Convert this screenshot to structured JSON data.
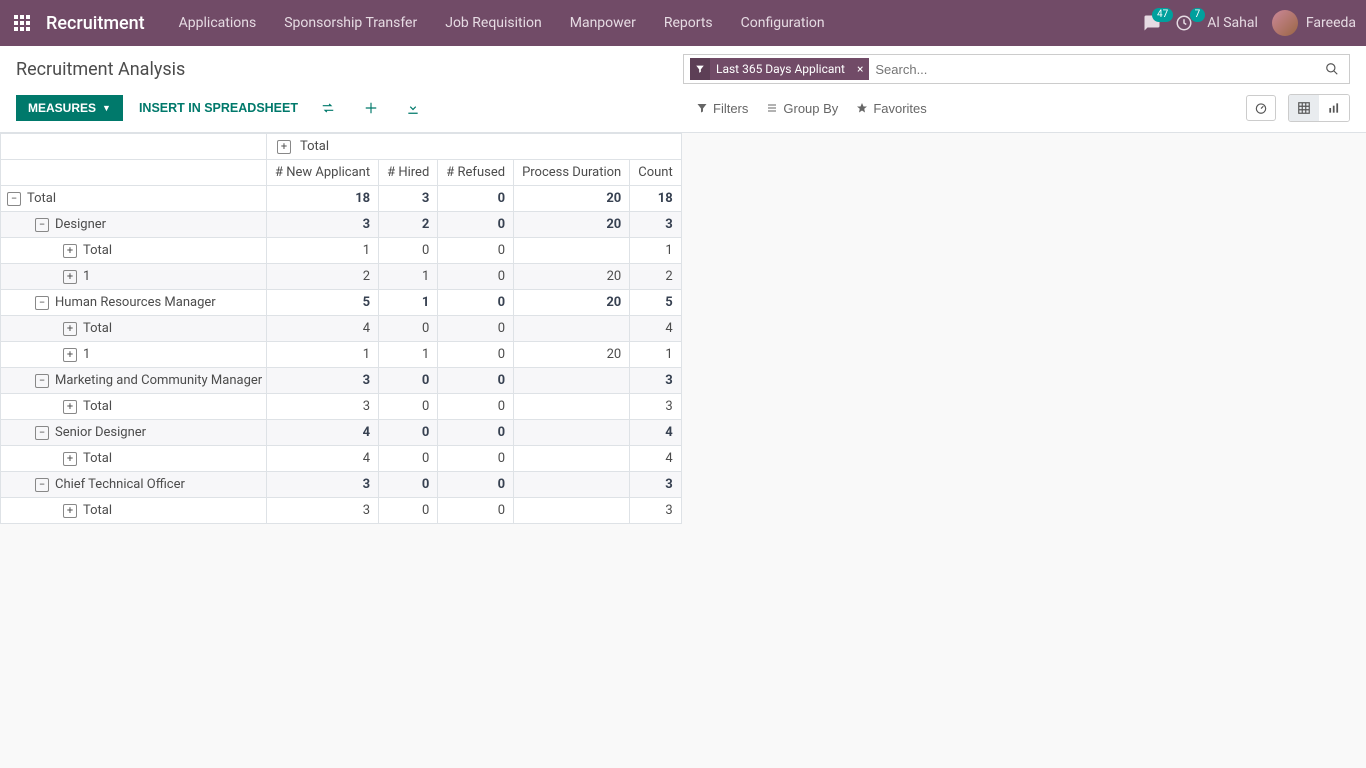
{
  "topnav": {
    "brand": "Recruitment",
    "menu": [
      "Applications",
      "Sponsorship Transfer",
      "Job Requisition",
      "Manpower",
      "Reports",
      "Configuration"
    ],
    "messages_badge": "47",
    "activities_badge": "7",
    "company": "Al Sahal",
    "username": "Fareeda"
  },
  "control_panel": {
    "title": "Recruitment Analysis",
    "search_chip": "Last 365 Days Applicant",
    "search_placeholder": "Search...",
    "measures_label": "Measures",
    "insert_label": "Insert in Spreadsheet",
    "filters_label": "Filters",
    "groupby_label": "Group By",
    "favorites_label": "Favorites"
  },
  "pivot": {
    "col_group_label": "Total",
    "measure_headers": [
      "# New Applicant",
      "# Hired",
      "# Refused",
      "Process Duration",
      "Count"
    ],
    "rows": [
      {
        "label": "Total",
        "indent": 0,
        "toggle": "minus",
        "bold": true,
        "stripe": false,
        "vals": [
          "18",
          "3",
          "0",
          "20",
          "18"
        ]
      },
      {
        "label": "Designer",
        "indent": 1,
        "toggle": "minus",
        "bold": true,
        "stripe": true,
        "vals": [
          "3",
          "2",
          "0",
          "20",
          "3"
        ]
      },
      {
        "label": "Total",
        "indent": 2,
        "toggle": "plus",
        "bold": false,
        "stripe": false,
        "vals": [
          "1",
          "0",
          "0",
          "",
          "1"
        ]
      },
      {
        "label": "1",
        "indent": 2,
        "toggle": "plus",
        "bold": false,
        "stripe": true,
        "vals": [
          "2",
          "1",
          "0",
          "20",
          "2"
        ]
      },
      {
        "label": "Human Resources Manager",
        "indent": 1,
        "toggle": "minus",
        "bold": true,
        "stripe": false,
        "vals": [
          "5",
          "1",
          "0",
          "20",
          "5"
        ]
      },
      {
        "label": "Total",
        "indent": 2,
        "toggle": "plus",
        "bold": false,
        "stripe": true,
        "vals": [
          "4",
          "0",
          "0",
          "",
          "4"
        ]
      },
      {
        "label": "1",
        "indent": 2,
        "toggle": "plus",
        "bold": false,
        "stripe": false,
        "vals": [
          "1",
          "1",
          "0",
          "20",
          "1"
        ]
      },
      {
        "label": "Marketing and Community Manager",
        "indent": 1,
        "toggle": "minus",
        "bold": true,
        "stripe": true,
        "vals": [
          "3",
          "0",
          "0",
          "",
          "3"
        ]
      },
      {
        "label": "Total",
        "indent": 2,
        "toggle": "plus",
        "bold": false,
        "stripe": false,
        "vals": [
          "3",
          "0",
          "0",
          "",
          "3"
        ]
      },
      {
        "label": "Senior Designer",
        "indent": 1,
        "toggle": "minus",
        "bold": true,
        "stripe": true,
        "vals": [
          "4",
          "0",
          "0",
          "",
          "4"
        ]
      },
      {
        "label": "Total",
        "indent": 2,
        "toggle": "plus",
        "bold": false,
        "stripe": false,
        "vals": [
          "4",
          "0",
          "0",
          "",
          "4"
        ]
      },
      {
        "label": "Chief Technical Officer",
        "indent": 1,
        "toggle": "minus",
        "bold": true,
        "stripe": true,
        "vals": [
          "3",
          "0",
          "0",
          "",
          "3"
        ]
      },
      {
        "label": "Total",
        "indent": 2,
        "toggle": "plus",
        "bold": false,
        "stripe": false,
        "vals": [
          "3",
          "0",
          "0",
          "",
          "3"
        ]
      }
    ]
  }
}
